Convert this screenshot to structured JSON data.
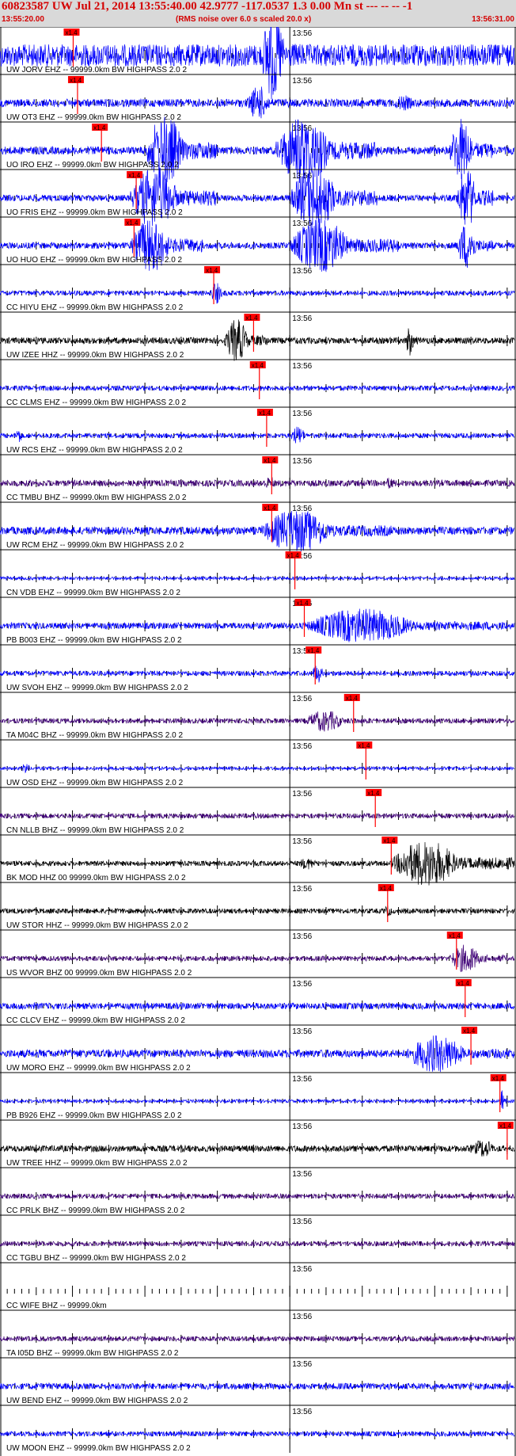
{
  "header": {
    "title": "60823587 UW Jul 21, 2014 13:55:40.00   42.9777 -117.0537  1.3 0.00 Mn st --- -- --  -1",
    "start_time": "13:55:20.00",
    "scale_note": "(RMS noise over 6.0 s scaled 20.0 x)",
    "end_time": "13:56:31.00"
  },
  "chart_data": {
    "type": "line",
    "minute_label": "13:56",
    "pick_label": "x1.4",
    "time_window": [
      "13:55:20.00",
      "13:56:31.00"
    ],
    "traces": [
      {
        "label": "UW JORV EHZ -- 99999.0km BW  HIGHPASS  2.0  2",
        "color": "#0000ff",
        "pick_time": 10.1,
        "amp": 14,
        "events": [
          [
            36,
            42,
            60
          ]
        ]
      },
      {
        "label": "UW OT3 EHZ -- 99999.0km BW  HIGHPASS  2.0  2",
        "color": "#0000ff",
        "pick_time": 10.7,
        "amp": 5,
        "events": [
          [
            34,
            40,
            22
          ],
          [
            54,
            60,
            10
          ]
        ]
      },
      {
        "label": "UO IRO EHZ -- 99999.0km BW  HIGHPASS  2.0  2",
        "color": "#0000ff",
        "pick_time": 14.0,
        "amp": 5,
        "events": [
          [
            20,
            30,
            45
          ],
          [
            38,
            52,
            45
          ],
          [
            62,
            68,
            40
          ]
        ]
      },
      {
        "label": "UO FRIS EHZ -- 99999.0km BW  HIGHPASS  2.0  2",
        "color": "#0000ff",
        "pick_time": 18.8,
        "amp": 4,
        "events": [
          [
            18,
            30,
            40
          ],
          [
            40,
            52,
            40
          ],
          [
            63,
            68,
            40
          ]
        ]
      },
      {
        "label": "UO HUO EHZ -- 99999.0km BW  HIGHPASS  2.0  2",
        "color": "#0000ff",
        "pick_time": 18.5,
        "amp": 4,
        "events": [
          [
            18,
            28,
            35
          ],
          [
            40,
            55,
            35
          ],
          [
            63,
            68,
            30
          ]
        ]
      },
      {
        "label": "CC HIYU EHZ -- 99999.0km BW  HIGHPASS  2.0  2",
        "color": "#0000ff",
        "pick_time": 29.5,
        "amp": 3,
        "events": [
          [
            29,
            32,
            14
          ]
        ]
      },
      {
        "label": "UW IZEE HHZ -- 99999.0km BW  HIGHPASS  2.0  2",
        "color": "#000000",
        "pick_time": 35.0,
        "amp": 4,
        "events": [
          [
            31,
            37,
            28
          ],
          [
            56,
            58,
            20
          ]
        ]
      },
      {
        "label": "CC CLMS EHZ -- 99999.0km BW  HIGHPASS  2.0  2",
        "color": "#0000ff",
        "pick_time": 35.8,
        "amp": 3,
        "events": []
      },
      {
        "label": "UW RCS EHZ -- 99999.0km BW  HIGHPASS  2.0  2",
        "color": "#0000ff",
        "pick_time": 36.8,
        "amp": 3,
        "events": [
          [
            2,
            4,
            10
          ],
          [
            40,
            44,
            12
          ]
        ]
      },
      {
        "label": "CC TMBU BHZ -- 99999.0km BW  HIGHPASS  2.0  2",
        "color": "#3f0077",
        "pick_time": 37.5,
        "amp": 4,
        "events": [
          [
            36,
            40,
            8
          ],
          [
            53,
            56,
            8
          ]
        ]
      },
      {
        "label": "UW RCM EHZ -- 99999.0km BW  HIGHPASS  2.0  2",
        "color": "#0000ff",
        "pick_time": 37.5,
        "amp": 5,
        "events": [
          [
            36,
            54,
            28
          ]
        ]
      },
      {
        "label": "CN VDB EHZ -- 99999.0km BW  HIGHPASS  2.0  2",
        "color": "#0000ff",
        "pick_time": 40.7,
        "amp": 2,
        "events": []
      },
      {
        "label": "PB B003 EHZ -- 99999.0km BW  HIGHPASS  2.0  2",
        "color": "#0000ff",
        "pick_time": 42.0,
        "amp": 4,
        "events": [
          [
            42,
            70,
            22
          ]
        ]
      },
      {
        "label": "UW SVOH EHZ -- 99999.0km BW  HIGHPASS  2.0  2",
        "color": "#0000ff",
        "pick_time": 43.5,
        "amp": 3,
        "events": [
          [
            43,
            46,
            12
          ]
        ]
      },
      {
        "label": "TA M04C BHZ -- 99999.0km BW  HIGHPASS  2.0  2",
        "color": "#3f0077",
        "pick_time": 48.8,
        "amp": 3,
        "events": [
          [
            42,
            52,
            14
          ]
        ]
      },
      {
        "label": "UW OSD EHZ -- 99999.0km BW  HIGHPASS  2.0  2",
        "color": "#0000ff",
        "pick_time": 50.5,
        "amp": 2,
        "events": [
          [
            3,
            5,
            8
          ]
        ]
      },
      {
        "label": "CN NLLB BHZ -- 99999.0km BW  HIGHPASS  2.0  2",
        "color": "#3f0077",
        "pick_time": 51.8,
        "amp": 3,
        "events": []
      },
      {
        "label": "BK MOD HHZ 00 99999.0km BW  HIGHPASS  2.0  2",
        "color": "#000000",
        "pick_time": 54.0,
        "amp": 3,
        "events": [
          [
            41,
            46,
            8
          ],
          [
            54,
            71,
            30
          ]
        ]
      },
      {
        "label": "UW STOR HHZ -- 99999.0km BW  HIGHPASS  2.0  2",
        "color": "#000000",
        "pick_time": 53.5,
        "amp": 3,
        "events": [
          [
            53,
            55,
            8
          ]
        ]
      },
      {
        "label": "US WVOR BHZ 00 99999.0km BW  HIGHPASS  2.0  2",
        "color": "#3f0077",
        "pick_time": 63.0,
        "amp": 3,
        "events": [
          [
            62,
            70,
            18
          ]
        ]
      },
      {
        "label": "CC CLCV EHZ -- 99999.0km BW  HIGHPASS  2.0  2",
        "color": "#0000ff",
        "pick_time": 64.2,
        "amp": 4,
        "events": []
      },
      {
        "label": "UW MORO EHZ -- 99999.0km BW  HIGHPASS  2.0  2",
        "color": "#0000ff",
        "pick_time": 65.0,
        "amp": 5,
        "events": [
          [
            56,
            71,
            24
          ]
        ]
      },
      {
        "label": "PB B926 EHZ -- 99999.0km BW  HIGHPASS  2.0  2",
        "color": "#0000ff",
        "pick_time": 69.0,
        "amp": 2,
        "events": [
          [
            69,
            70,
            14
          ]
        ]
      },
      {
        "label": "UW TREE HHZ -- 99999.0km BW  HIGHPASS  2.0  2",
        "color": "#000000",
        "pick_time": 70.0,
        "amp": 4,
        "events": [
          [
            65,
            71,
            12
          ]
        ]
      },
      {
        "label": "CC PRLK BHZ -- 99999.0km BW  HIGHPASS  2.0  2",
        "color": "#3f0077",
        "pick_time": null,
        "amp": 3,
        "events": []
      },
      {
        "label": "CC TGBU BHZ -- 99999.0km BW  HIGHPASS  2.0  2",
        "color": "#3f0077",
        "pick_time": null,
        "amp": 3,
        "events": []
      },
      {
        "label": "CC WIFE BHZ -- 99999.0km",
        "color": "#3f0077",
        "pick_time": null,
        "amp": 0,
        "events": []
      },
      {
        "label": "TA I05D BHZ -- 99999.0km BW  HIGHPASS  2.0  2",
        "color": "#3f0077",
        "pick_time": null,
        "amp": 3,
        "events": []
      },
      {
        "label": "UW BEND EHZ -- 99999.0km BW  HIGHPASS  2.0  2",
        "color": "#0000ff",
        "pick_time": null,
        "amp": 4,
        "events": []
      },
      {
        "label": "UW MOON EHZ -- 99999.0km BW  HIGHPASS  2.0  2",
        "color": "#0000ff",
        "pick_time": null,
        "amp": 3,
        "events": []
      }
    ]
  }
}
